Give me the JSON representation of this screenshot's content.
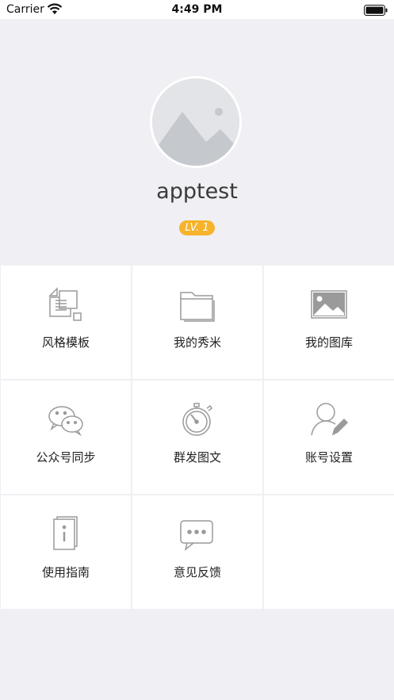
{
  "status_bar": {
    "carrier": "Carrier",
    "time": "4:49 PM"
  },
  "profile": {
    "username": "apptest",
    "level": "LV. 1"
  },
  "menu": [
    {
      "label": "风格模板",
      "icon": "template-icon"
    },
    {
      "label": "我的秀米",
      "icon": "folder-icon"
    },
    {
      "label": "我的图库",
      "icon": "image-gallery-icon"
    },
    {
      "label": "公众号同步",
      "icon": "wechat-icon"
    },
    {
      "label": "群发图文",
      "icon": "stopwatch-icon"
    },
    {
      "label": "账号设置",
      "icon": "user-edit-icon"
    },
    {
      "label": "使用指南",
      "icon": "guide-book-icon"
    },
    {
      "label": "意见反馈",
      "icon": "feedback-icon"
    }
  ],
  "colors": {
    "background": "#efeff4",
    "badge": "#f6b32b",
    "icon_gray": "#9a9a9a"
  }
}
